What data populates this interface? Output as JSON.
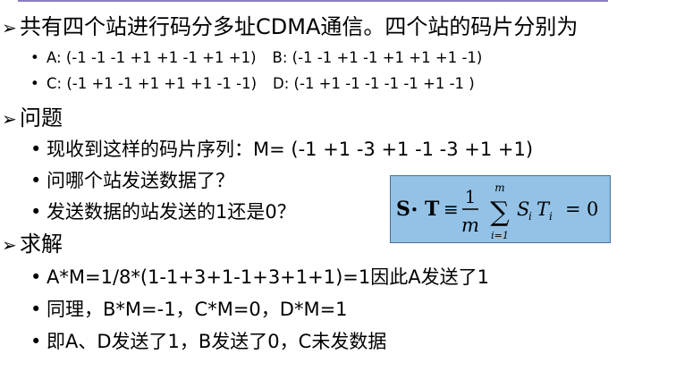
{
  "heading1": "共有四个站进行码分多址CDMA通信。四个站的码片分别为",
  "codes": {
    "a_label": "A:",
    "a_value": "(-1 -1 -1 +1 +1 -1 +1 +1)",
    "b_label": "B:",
    "b_value": "(-1 -1 +1 -1 +1 +1 +1 -1)",
    "c_label": "C:",
    "c_value": "(-1 +1 -1 +1 +1 +1 -1 -1)",
    "d_label": "D:",
    "d_value": "(-1 +1 -1 -1 -1 -1 +1 -1 )"
  },
  "heading2": "问题",
  "questions": [
    "现收到这样的码片序列：M= (-1 +1 -3 +1 -1 -3 +1 +1)",
    "问哪个站发送数据了？",
    "发送数据的站发送的1还是0？"
  ],
  "formula": {
    "lhs_s": "S",
    "dot": "•",
    "lhs_t": "T",
    "equiv": "≡",
    "numerator": "1",
    "denominator": "m",
    "sigma": "∑",
    "upper": "m",
    "lower": "i=1",
    "term_s": "S",
    "sub_i1": "i",
    "term_t": "T",
    "sub_i2": "i",
    "equals": "=",
    "zero": "0"
  },
  "heading3": "求解",
  "solutions": [
    "A*M=1/8*(1-1+3+1-1+3+1+1)=1因此A发送了1",
    "同理，B*M=-1，C*M=0，D*M=1",
    "即A、D发送了1，B发送了0，C未发数据"
  ],
  "colors": {
    "formula_bg": "#93c2e6",
    "formula_border": "#4a6f96",
    "top_rule": "#8a7fc0"
  },
  "icons": {
    "heading_marker": "arrowhead",
    "list_marker": "bullet"
  }
}
